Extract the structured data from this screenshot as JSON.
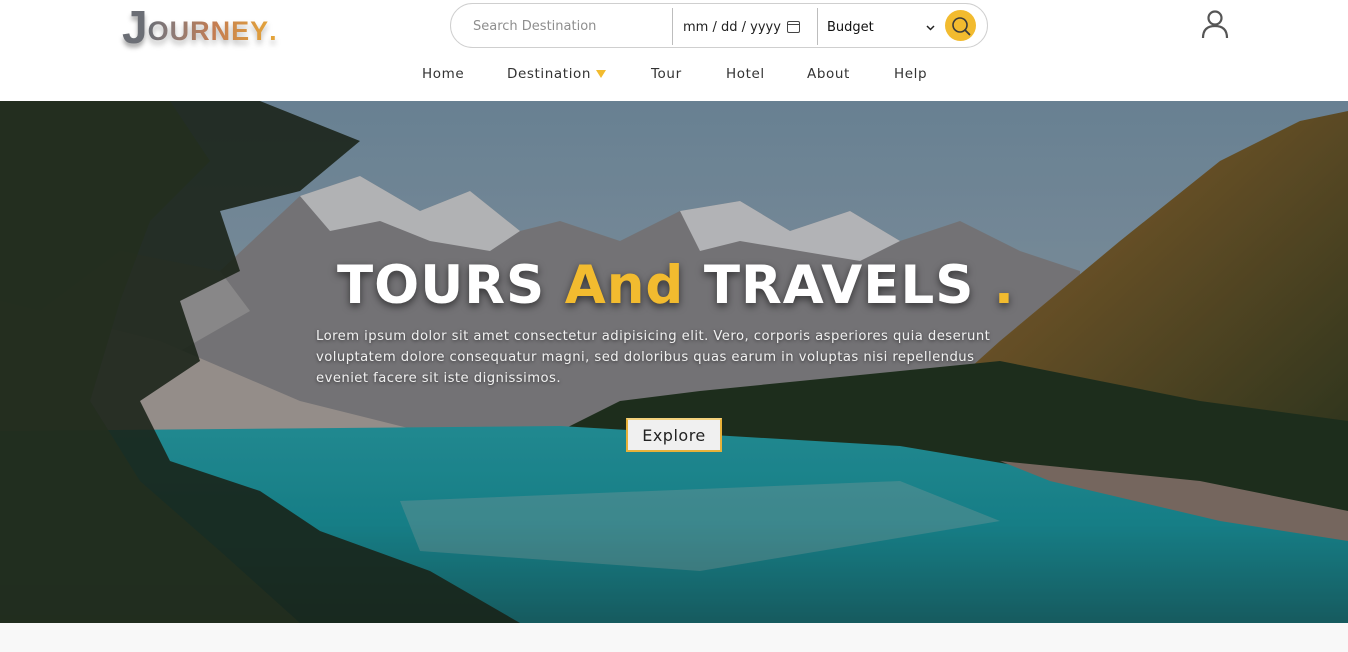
{
  "logo": {
    "first_letter": "J",
    "rest": "OURNEY",
    "dot": "."
  },
  "search": {
    "destination_placeholder": "Search Destination",
    "date_placeholder": "mm / dd / yyyy",
    "budget_selected": "Budget"
  },
  "nav": {
    "items": [
      {
        "label": "Home"
      },
      {
        "label": "Destination"
      },
      {
        "label": "Tour"
      },
      {
        "label": "Hotel"
      },
      {
        "label": "About"
      },
      {
        "label": "Help"
      }
    ]
  },
  "hero": {
    "title_part1": "TOURS",
    "title_accent": "And",
    "title_part2": "TRAVELS",
    "title_dot": ".",
    "description": "Lorem ipsum dolor sit amet consectetur adipisicing elit. Vero, corporis asperiores quia deserunt voluptatem dolore consequatur magni, sed doloribus quas earum in voluptas nisi repellendus eveniet facere sit iste dignissimos.",
    "explore_label": "Explore"
  },
  "colors": {
    "accent": "#f2bb2f",
    "nav_text": "#333333",
    "hero_text": "#ffffff"
  },
  "icons": {
    "search_button": "search-icon",
    "user": "user-icon",
    "calendar": "calendar-icon",
    "select_arrow": "chevron-down-icon",
    "dropdown": "caret-down-icon"
  }
}
